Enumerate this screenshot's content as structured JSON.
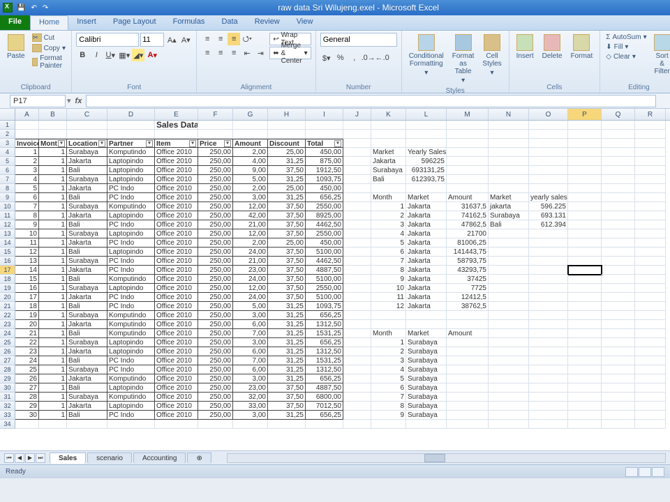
{
  "title": "raw data Sri Wilujeng.exel - Microsoft Excel",
  "tabs": {
    "file": "File",
    "home": "Home",
    "insert": "Insert",
    "page_layout": "Page Layout",
    "formulas": "Formulas",
    "data": "Data",
    "review": "Review",
    "view": "View"
  },
  "ribbon": {
    "clipboard": {
      "label": "Clipboard",
      "paste": "Paste",
      "cut": "Cut",
      "copy": "Copy",
      "format_painter": "Format Painter"
    },
    "font": {
      "label": "Font",
      "name": "Calibri",
      "size": "11"
    },
    "alignment": {
      "label": "Alignment",
      "wrap": "Wrap Text",
      "merge": "Merge & Center"
    },
    "number": {
      "label": "Number",
      "format": "General"
    },
    "styles": {
      "label": "Styles",
      "cond": "Conditional Formatting",
      "table": "Format as Table",
      "cell": "Cell Styles"
    },
    "cells": {
      "label": "Cells",
      "insert": "Insert",
      "delete": "Delete",
      "format": "Format"
    },
    "editing": {
      "label": "Editing",
      "autosum": "AutoSum",
      "fill": "Fill",
      "clear": "Clear",
      "sort": "Sort & Filter"
    }
  },
  "namebox": "P17",
  "cols": [
    "A",
    "B",
    "C",
    "D",
    "E",
    "F",
    "G",
    "H",
    "I",
    "J",
    "K",
    "L",
    "M",
    "N",
    "O",
    "P",
    "Q",
    "R"
  ],
  "sheet_title": "Sales Data",
  "headers": [
    "Invoice",
    "Mont",
    "Location",
    "Partner",
    "Item",
    "Price",
    "Amount",
    "Discount",
    "Total"
  ],
  "table": [
    [
      1,
      1,
      "Surabaya",
      "Komputindo",
      "Office 2010",
      "250,00",
      "2,00",
      "25,00",
      "450,00"
    ],
    [
      2,
      1,
      "Jakarta",
      "Laptopindo",
      "Office 2010",
      "250,00",
      "4,00",
      "31,25",
      "875,00"
    ],
    [
      3,
      1,
      "Bali",
      "Laptopindo",
      "Office 2010",
      "250,00",
      "9,00",
      "37,50",
      "1912,50"
    ],
    [
      4,
      1,
      "Surabaya",
      "Laptopindo",
      "Office 2010",
      "250,00",
      "5,00",
      "31,25",
      "1093,75"
    ],
    [
      5,
      1,
      "Jakarta",
      "PC Indo",
      "Office 2010",
      "250,00",
      "2,00",
      "25,00",
      "450,00"
    ],
    [
      6,
      1,
      "Bali",
      "PC Indo",
      "Office 2010",
      "250,00",
      "3,00",
      "31,25",
      "656,25"
    ],
    [
      7,
      1,
      "Surabaya",
      "Komputindo",
      "Office 2010",
      "250,00",
      "12,00",
      "37,50",
      "2550,00"
    ],
    [
      8,
      1,
      "Jakarta",
      "Laptopindo",
      "Office 2010",
      "250,00",
      "42,00",
      "37,50",
      "8925,00"
    ],
    [
      9,
      1,
      "Bali",
      "PC Indo",
      "Office 2010",
      "250,00",
      "21,00",
      "37,50",
      "4462,50"
    ],
    [
      10,
      1,
      "Surabaya",
      "Laptopindo",
      "Office 2010",
      "250,00",
      "12,00",
      "37,50",
      "2550,00"
    ],
    [
      11,
      1,
      "Jakarta",
      "PC Indo",
      "Office 2010",
      "250,00",
      "2,00",
      "25,00",
      "450,00"
    ],
    [
      12,
      1,
      "Bali",
      "Laptopindo",
      "Office 2010",
      "250,00",
      "24,00",
      "37,50",
      "5100,00"
    ],
    [
      13,
      1,
      "Surabaya",
      "PC Indo",
      "Office 2010",
      "250,00",
      "21,00",
      "37,50",
      "4462,50"
    ],
    [
      14,
      1,
      "Jakarta",
      "PC Indo",
      "Office 2010",
      "250,00",
      "23,00",
      "37,50",
      "4887,50"
    ],
    [
      15,
      1,
      "Bali",
      "Komputindo",
      "Office 2010",
      "250,00",
      "24,00",
      "37,50",
      "5100,00"
    ],
    [
      16,
      1,
      "Surabaya",
      "Laptopindo",
      "Office 2010",
      "250,00",
      "12,00",
      "37,50",
      "2550,00"
    ],
    [
      17,
      1,
      "Jakarta",
      "PC Indo",
      "Office 2010",
      "250,00",
      "24,00",
      "37,50",
      "5100,00"
    ],
    [
      18,
      1,
      "Bali",
      "PC Indo",
      "Office 2010",
      "250,00",
      "5,00",
      "31,25",
      "1093,75"
    ],
    [
      19,
      1,
      "Surabaya",
      "Komputindo",
      "Office 2010",
      "250,00",
      "3,00",
      "31,25",
      "656,25"
    ],
    [
      20,
      1,
      "Jakarta",
      "Komputindo",
      "Office 2010",
      "250,00",
      "6,00",
      "31,25",
      "1312,50"
    ],
    [
      21,
      1,
      "Bali",
      "Komputindo",
      "Office 2010",
      "250,00",
      "7,00",
      "31,25",
      "1531,25"
    ],
    [
      22,
      1,
      "Surabaya",
      "Laptopindo",
      "Office 2010",
      "250,00",
      "3,00",
      "31,25",
      "656,25"
    ],
    [
      23,
      1,
      "Jakarta",
      "Laptopindo",
      "Office 2010",
      "250,00",
      "6,00",
      "31,25",
      "1312,50"
    ],
    [
      24,
      1,
      "Bali",
      "PC Indo",
      "Office 2010",
      "250,00",
      "7,00",
      "31,25",
      "1531,25"
    ],
    [
      25,
      1,
      "Surabaya",
      "PC Indo",
      "Office 2010",
      "250,00",
      "6,00",
      "31,25",
      "1312,50"
    ],
    [
      26,
      1,
      "Jakarta",
      "Komputindo",
      "Office 2010",
      "250,00",
      "3,00",
      "31,25",
      "656,25"
    ],
    [
      27,
      1,
      "Bali",
      "Laptopindo",
      "Office 2010",
      "250,00",
      "23,00",
      "37,50",
      "4887,50"
    ],
    [
      28,
      1,
      "Surabaya",
      "Komputindo",
      "Office 2010",
      "250,00",
      "32,00",
      "37,50",
      "6800,00"
    ],
    [
      29,
      1,
      "Jakarta",
      "Laptopindo",
      "Office 2010",
      "250,00",
      "33,00",
      "37,50",
      "7012,50"
    ],
    [
      30,
      1,
      "Bali",
      "PC Indo",
      "Office 2010",
      "250,00",
      "3,00",
      "31,25",
      "656,25"
    ]
  ],
  "side": {
    "market_hdr": "Market",
    "yearly_hdr": "Yearly Sales",
    "markets": [
      [
        "Jakarta",
        "596225"
      ],
      [
        "Surabaya",
        "693131,25"
      ],
      [
        "Bali",
        "612393,75"
      ]
    ],
    "month_hdr": "Month",
    "market_hdr2": "Market",
    "amount_hdr": "Amount",
    "monthly": [
      [
        1,
        "Jakarta",
        "31637,5"
      ],
      [
        2,
        "Jakarta",
        "74162,5"
      ],
      [
        3,
        "Jakarta",
        "47862,5"
      ],
      [
        4,
        "Jakarta",
        "21700"
      ],
      [
        5,
        "Jakarta",
        "81006,25"
      ],
      [
        6,
        "Jakarta",
        "141443,75"
      ],
      [
        7,
        "Jakarta",
        "58793,75"
      ],
      [
        8,
        "Jakarta",
        "43293,75"
      ],
      [
        9,
        "Jakarta",
        "37425"
      ],
      [
        10,
        "Jakarta",
        "7725"
      ],
      [
        11,
        "Jakarta",
        "12412,5"
      ],
      [
        12,
        "Jakarta",
        "38762,5"
      ]
    ],
    "right_hdr_m": "Market",
    "right_hdr_y": "yearly sales",
    "right": [
      [
        "jakarta",
        "596.225"
      ],
      [
        "Surabaya",
        "693.131"
      ],
      [
        "Bali",
        "612.394"
      ]
    ],
    "summary2": [
      [
        1,
        "Surabaya"
      ],
      [
        2,
        "Surabaya"
      ],
      [
        3,
        "Surabaya"
      ],
      [
        4,
        "Surabaya"
      ],
      [
        5,
        "Surabaya"
      ],
      [
        6,
        "Surabaya"
      ],
      [
        7,
        "Surabaya"
      ],
      [
        8,
        "Surabaya"
      ],
      [
        9,
        "Surabaya"
      ]
    ]
  },
  "sheets": [
    "Sales",
    "scenario",
    "Accounting"
  ],
  "status": "Ready",
  "selected_cell": "P17",
  "selected_row": 17,
  "selected_col": "P"
}
